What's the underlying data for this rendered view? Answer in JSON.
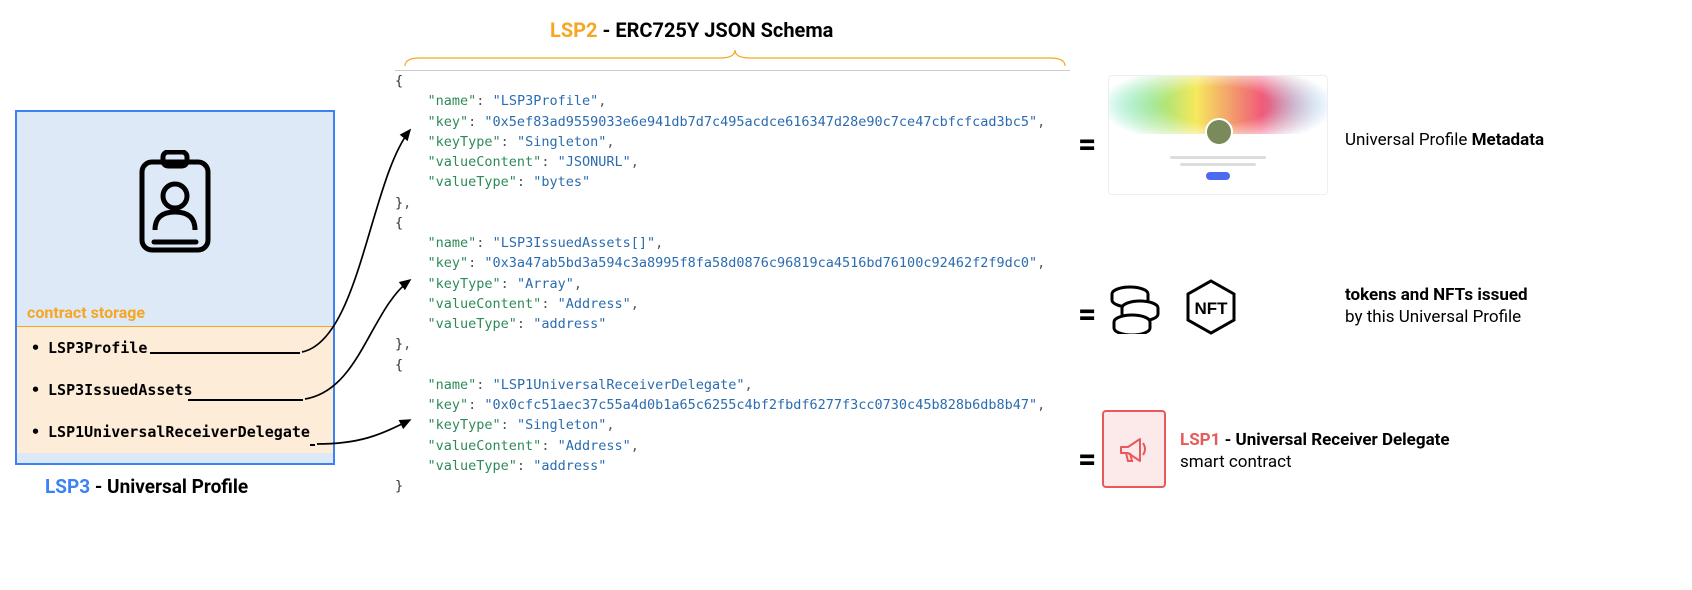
{
  "title": {
    "lsp2": "LSP2",
    "schema": " - ERC725Y JSON Schema"
  },
  "contract": {
    "storage_label": "contract storage",
    "items": [
      "LSP3Profile",
      "LSP3IssuedAssets",
      "LSP1UniversalReceiverDelegate"
    ]
  },
  "caption": {
    "lsp3": "LSP3",
    "rest": " - Universal Profile"
  },
  "code": {
    "entries": [
      {
        "name": "LSP3Profile",
        "key": "0x5ef83ad9559033e6e941db7d7c495acdce616347d28e90c7ce47cbfcfcad3bc5",
        "keyType": "Singleton",
        "valueContent": "JSONURL",
        "valueType": "bytes"
      },
      {
        "name": "LSP3IssuedAssets[]",
        "key": "0x3a47ab5bd3a594c3a8995f8fa58d0876c96819ca4516bd76100c92462f2f9dc0",
        "keyType": "Array",
        "valueContent": "Address",
        "valueType": "address"
      },
      {
        "name": "LSP1UniversalReceiverDelegate",
        "key": "0x0cfc51aec37c55a4d0b1a65c6255c4bf2fbdf6277f3cc0730c45b828b6db8b47",
        "keyType": "Singleton",
        "valueContent": "Address",
        "valueType": "address"
      }
    ]
  },
  "right": {
    "metadata": "Universal Profile ",
    "metadata_bold": "Metadata",
    "tokens_main": "tokens and NFTs issued",
    "tokens_sub": "by this Universal Profile",
    "lsp1_red": "LSP1",
    "lsp1_rest": " - Universal Receiver Delegate",
    "lsp1_sub": "smart contract"
  },
  "equals": "="
}
